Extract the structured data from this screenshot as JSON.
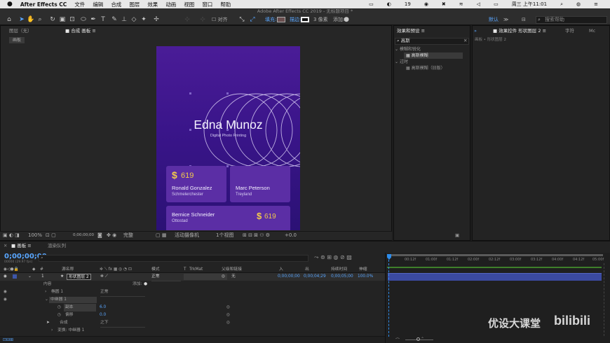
{
  "menubar": {
    "apple": "",
    "app": "After Effects CC",
    "items": [
      "文件",
      "编辑",
      "合成",
      "图层",
      "效果",
      "动画",
      "视图",
      "窗口",
      "帮助"
    ],
    "status": {
      "battery_num": "19",
      "clock": "周三 上午11:01"
    }
  },
  "window_title": "Adobe After Effects CC 2019 - 无标题项目 *",
  "toolbar": {
    "align_label": "对齐",
    "fill_label": "填充:",
    "stroke_label": "描边:",
    "stroke_px": "3 像素",
    "add_label": "添加:",
    "default_label": "默认",
    "search_placeholder": "搜索帮助"
  },
  "panels": {
    "layer_tab": "图层（无）",
    "comp_tab": "合成 画板",
    "comp_crumb": "画板",
    "effects_tab": "效果和预设",
    "effects_search": "高斯",
    "effect_group1": "模糊和锐化",
    "effect_item1": "高斯模糊",
    "effect_group2": "过时",
    "effect_item2": "高斯模糊（旧版）",
    "effect_controls_tab": "效果控件 形状图层 2",
    "char_tab": "字符",
    "mc_tab": "Mc",
    "fx_crumb": "画板 • 形状图层 2"
  },
  "artboard": {
    "name": "Edna Munoz",
    "subtitle": "Digital Photo Printing",
    "card1_amount": "619",
    "card1_name": "Ronald Gonzalez",
    "card1_place": "Schmelerchester",
    "card2_name": "Marc Peterson",
    "card2_place": "Treyland",
    "card3_name": "Bernice Schneider",
    "card3_place": "Ottostad",
    "card3_amount": "619",
    "currency": "$"
  },
  "viewer_bar": {
    "zoom": "100%",
    "time": "0;00;00;00",
    "quality": "完整",
    "camera": "活动摄像机",
    "views": "1个视图",
    "offset": "+0.0"
  },
  "timeline": {
    "tab1": "画板",
    "tab2": "渲染队列",
    "timecode": "0;00;00;00",
    "fps": "00000 (29.97 fps)",
    "cols": {
      "num": "#",
      "src": "源名称",
      "mode": "模式",
      "t": "T",
      "trkmat": "TrkMat",
      "parent": "父级和链接",
      "in": "入",
      "out": "出",
      "dur": "持续时间",
      "stretch": "伸缩"
    },
    "layer": {
      "index": "1",
      "name": "形状图层 2",
      "mode": "正常",
      "parent": "无",
      "in": "0;00;00;00",
      "out": "0;00;04;29",
      "dur": "0;00;05;00",
      "stretch": "100.0%"
    },
    "props": {
      "contents": "内容",
      "add": "添加:",
      "ellipse": "椭圆 1",
      "ellipse_mode": "正常",
      "repeater": "中继器 1",
      "copies": "副本",
      "copies_val": "6.0",
      "offset": "偏移",
      "offset_val": "0.0",
      "composite": "合成",
      "composite_val": "之下",
      "transform": "变换: 中继器 1"
    },
    "ruler": [
      "00:12f",
      "01:00f",
      "01:12f",
      "02:00f",
      "02:12f",
      "03:00f",
      "03:12f",
      "04:00f",
      "04:12f",
      "05:00f"
    ]
  },
  "watermark": {
    "text": "优设大课堂",
    "logo": "bilibili"
  },
  "colors": {
    "accent_blue": "#2d8ceb",
    "artboard_top": "#4b1f9a",
    "artboard_bottom": "#2a0f6e",
    "card": "#5a2ea6",
    "gold": "#f2c94c"
  }
}
